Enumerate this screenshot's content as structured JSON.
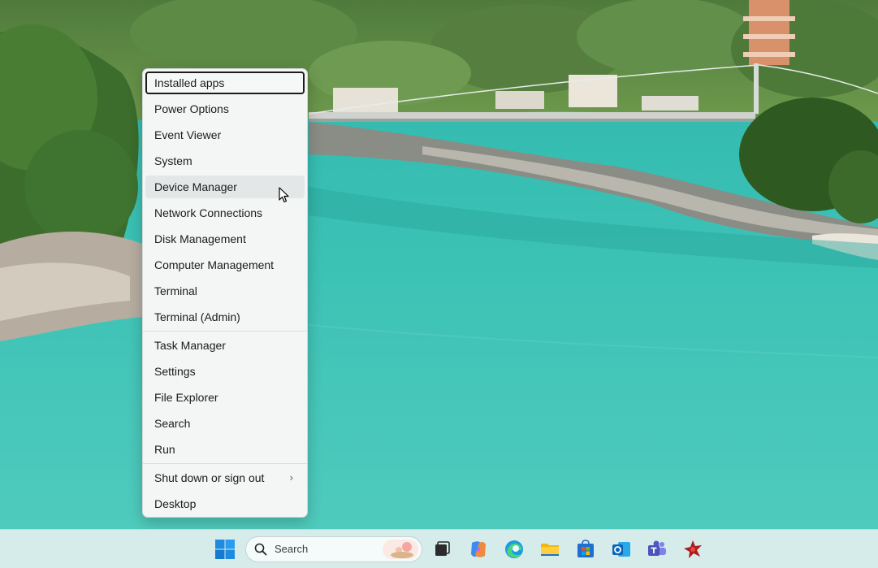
{
  "menu": {
    "items": [
      {
        "label": "Installed apps"
      },
      {
        "label": "Power Options"
      },
      {
        "label": "Event Viewer"
      },
      {
        "label": "System"
      },
      {
        "label": "Device Manager"
      },
      {
        "label": "Network Connections"
      },
      {
        "label": "Disk Management"
      },
      {
        "label": "Computer Management"
      },
      {
        "label": "Terminal"
      },
      {
        "label": "Terminal (Admin)"
      },
      {
        "label": "Task Manager"
      },
      {
        "label": "Settings"
      },
      {
        "label": "File Explorer"
      },
      {
        "label": "Search"
      },
      {
        "label": "Run"
      },
      {
        "label": "Shut down or sign out"
      },
      {
        "label": "Desktop"
      }
    ],
    "submenu_glyph": "›"
  },
  "taskbar": {
    "search": {
      "label": "Search"
    },
    "icons": [
      "windows-start-icon",
      "task-view-icon",
      "copilot-icon",
      "edge-icon",
      "file-explorer-icon",
      "store-icon",
      "outlook-icon",
      "teams-icon",
      "app-icon"
    ],
    "accent": "#0078d4"
  }
}
